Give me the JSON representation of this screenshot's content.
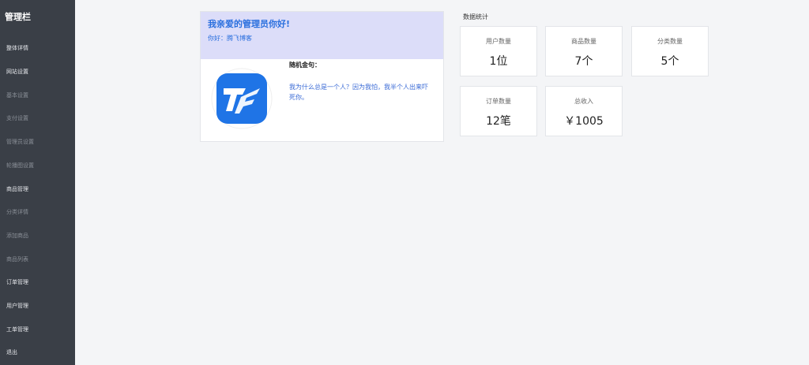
{
  "sidebar": {
    "title": "管理栏",
    "items": [
      {
        "label": "整体详情",
        "kind": "primary"
      },
      {
        "label": "网站设置",
        "kind": "primary"
      },
      {
        "label": "基本设置",
        "kind": "sub"
      },
      {
        "label": "支付设置",
        "kind": "sub"
      },
      {
        "label": "管理员设置",
        "kind": "sub"
      },
      {
        "label": "轮播图设置",
        "kind": "sub"
      },
      {
        "label": "商品管理",
        "kind": "primary"
      },
      {
        "label": "分类详情",
        "kind": "sub"
      },
      {
        "label": "添加商品",
        "kind": "sub"
      },
      {
        "label": "商品列表",
        "kind": "sub"
      },
      {
        "label": "订单管理",
        "kind": "primary"
      },
      {
        "label": "用户管理",
        "kind": "primary"
      },
      {
        "label": "工单管理",
        "kind": "primary"
      },
      {
        "label": "退出",
        "kind": "primary"
      }
    ]
  },
  "welcome": {
    "title": "我亲爱的管理员你好!",
    "greeting": "你好：腾飞博客",
    "logo_icon": "tf-logo-icon",
    "quote_label": "随机金句：",
    "quote_text": "我为什么总是一个人？因为我怕，我半个人出来吓死你。"
  },
  "stats": {
    "title": "数据统计",
    "cards": [
      {
        "label": "用户数量",
        "value": "1位"
      },
      {
        "label": "商品数量",
        "value": "7个"
      },
      {
        "label": "分类数量",
        "value": "5个"
      },
      {
        "label": "订单数量",
        "value": "12笔"
      },
      {
        "label": "总收入",
        "value": "￥1005"
      }
    ]
  },
  "colors": {
    "sidebar_bg": "#3a3f47",
    "welcome_head_bg": "#dcddf9",
    "accent_blue": "#2a6fde",
    "logo_blue": "#1f74e6"
  }
}
